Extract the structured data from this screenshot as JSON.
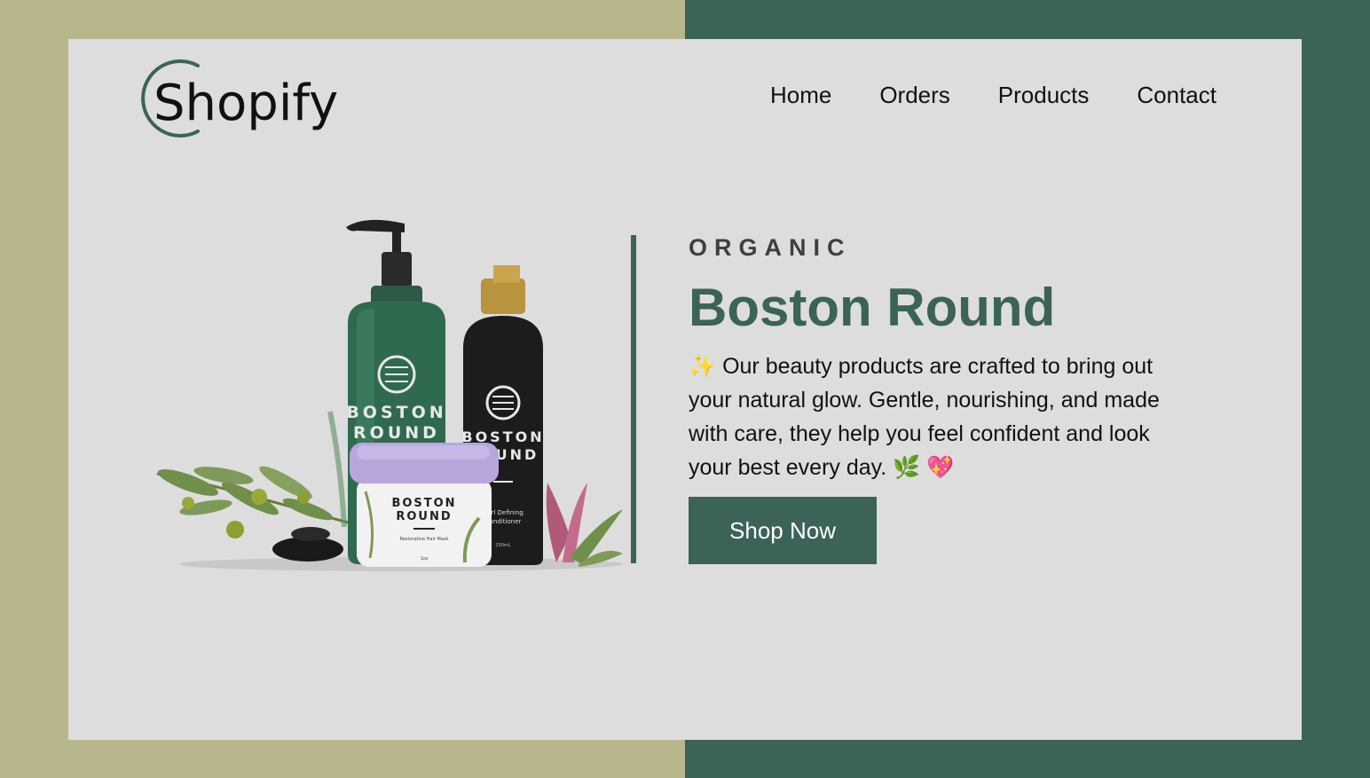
{
  "brand": {
    "logo_text": "Shopify"
  },
  "nav": {
    "items": [
      "Home",
      "Orders",
      "Products",
      "Contact"
    ]
  },
  "hero": {
    "eyebrow": "ORGANIC",
    "title": "Boston Round",
    "description": "✨ Our beauty products are crafted to bring out your natural glow. Gentle, nourishing, and made with care, they help you feel confident and look your best every day. 🌿 💖",
    "cta_label": "Shop Now"
  },
  "product_image": {
    "pump_bottle_label": [
      "BOSTON",
      "ROUND"
    ],
    "black_bottle_label": [
      "BOSTON",
      "ROUND"
    ],
    "black_bottle_sub": [
      "Curl Defining",
      "Conditioner"
    ],
    "black_bottle_size": "250mL",
    "jar_label": [
      "BOSTON",
      "ROUND"
    ],
    "jar_sub": "Restorative Hair Mask",
    "jar_size": "1oz"
  },
  "colors": {
    "left_bg": "#b7b78b",
    "right_bg": "#3b6357",
    "card_bg": "#dddddd",
    "accent": "#3b6357"
  }
}
